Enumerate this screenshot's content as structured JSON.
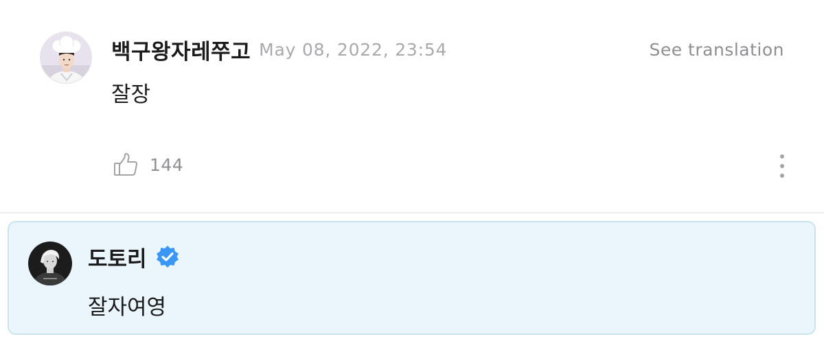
{
  "comment": {
    "avatar_icon": "user-avatar-chef-hat",
    "username": "백구왕자레쭈고",
    "timestamp": "May 08, 2022, 23:54",
    "translate_label": "See translation",
    "body": "잘장",
    "like_icon": "thumbs-up-icon",
    "like_count": "144",
    "more_icon": "more-vertical-icon"
  },
  "reply": {
    "avatar_icon": "artist-avatar",
    "username": "도토리",
    "verified_icon": "verified-badge-icon",
    "body": "잘자여영"
  },
  "colors": {
    "reply_background": "#eaf6fc",
    "reply_border": "#c9e4ee",
    "verified_badge": "#3b97f5",
    "muted_text": "#8e8e93"
  }
}
